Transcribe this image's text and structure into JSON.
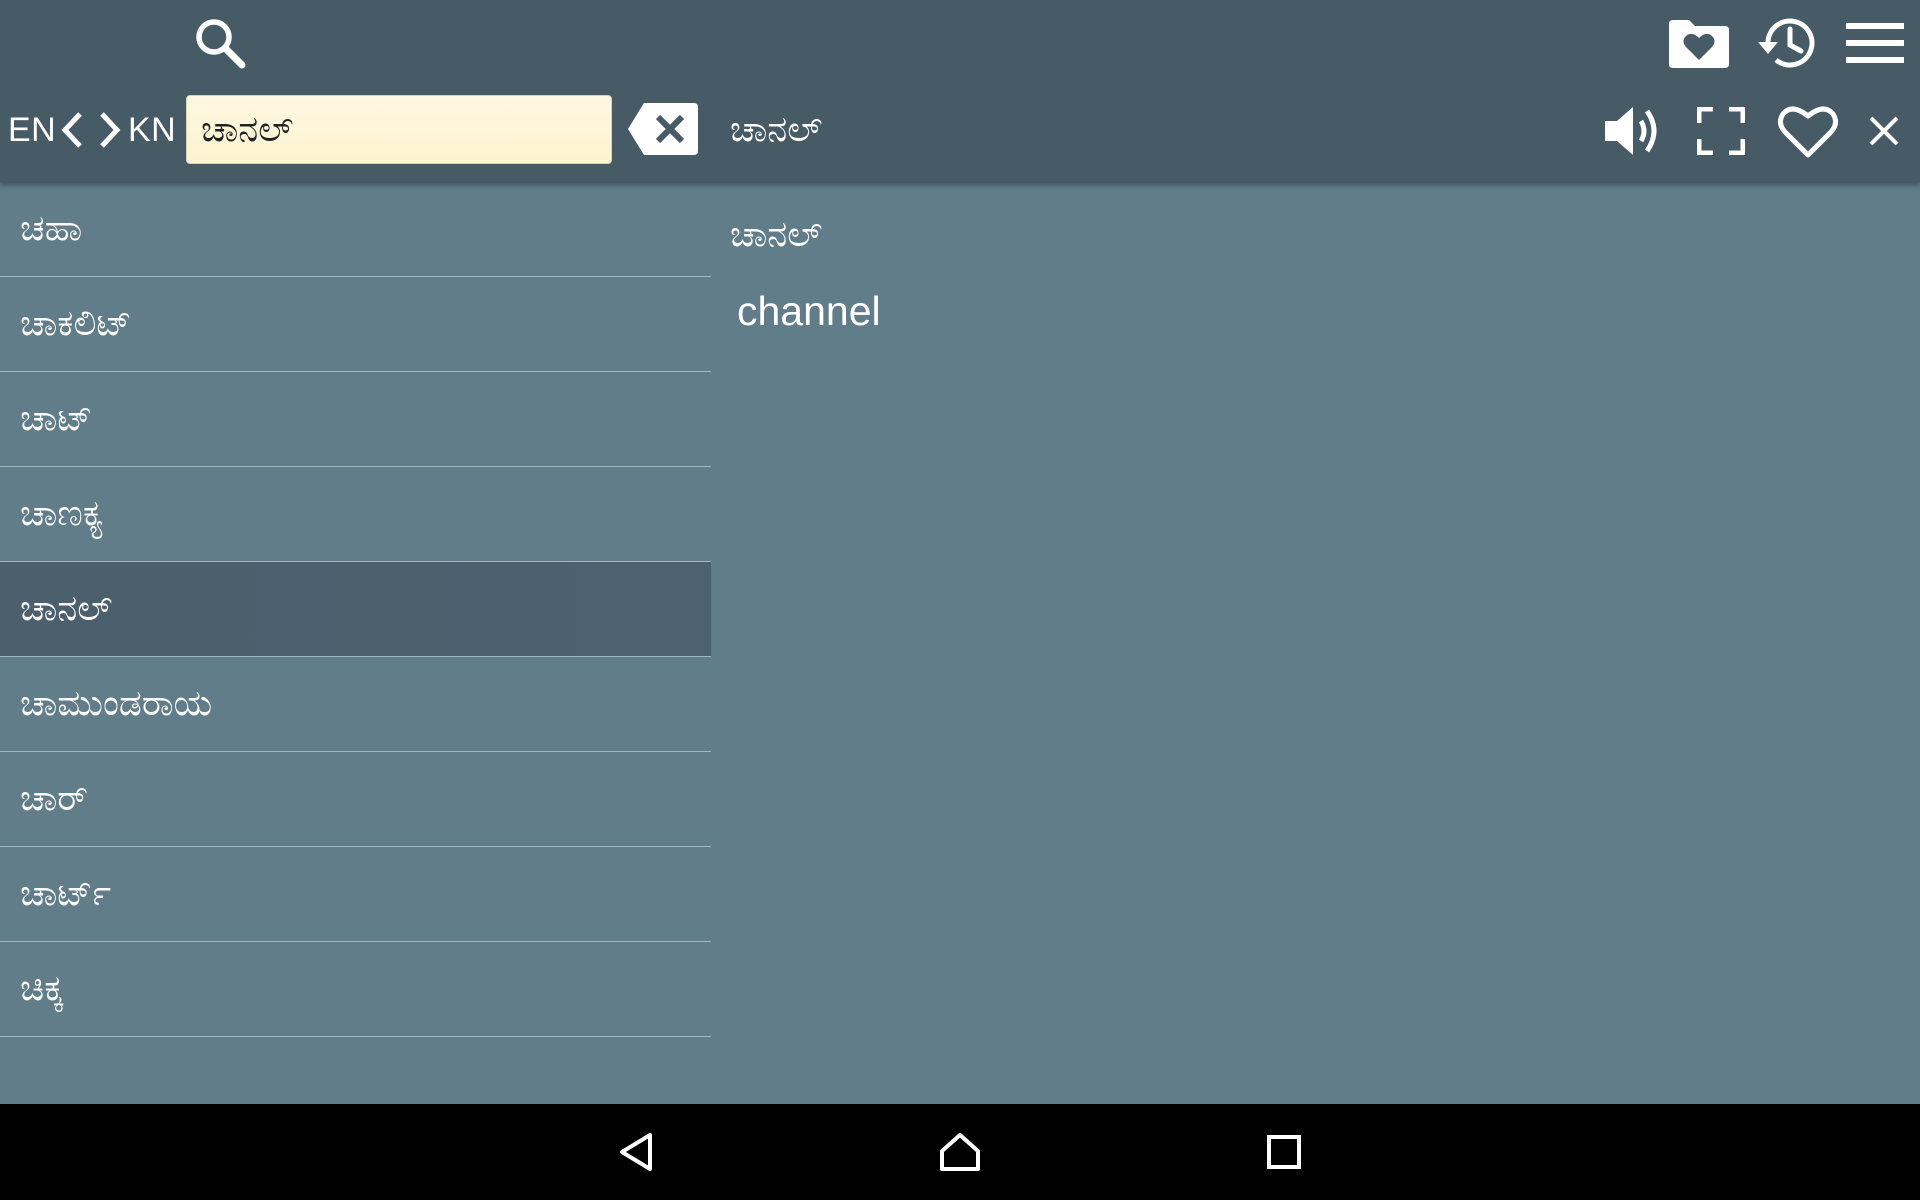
{
  "toolbar": {
    "search_icon": "search-icon",
    "favorites_folder_icon": "favorites-folder-icon",
    "history_icon": "history-icon",
    "menu_icon": "menu-icon"
  },
  "language_bar": {
    "source_lang": "EN",
    "target_lang": "KN",
    "prev_icon": "chevron-left-icon",
    "next_icon": "chevron-right-icon"
  },
  "search": {
    "value": "ಚಾನಲ್",
    "clear_icon": "backspace-clear-icon"
  },
  "header": {
    "current_word": "ಚಾನಲ್",
    "actions": [
      "speaker-icon",
      "fullscreen-icon",
      "heart-icon",
      "close-icon"
    ]
  },
  "word_list": {
    "items": [
      {
        "label": "ಚಹಾ",
        "selected": false
      },
      {
        "label": "ಚಾಕಲಿಟ್",
        "selected": false
      },
      {
        "label": "ಚಾಟ್",
        "selected": false
      },
      {
        "label": "ಚಾಣಕ್ಯ",
        "selected": false
      },
      {
        "label": "ಚಾನಲ್",
        "selected": true
      },
      {
        "label": "ಚಾಮುಂಡರಾಯ",
        "selected": false
      },
      {
        "label": "ಚಾರ್",
        "selected": false
      },
      {
        "label": "ಚಾರ್ಟ್",
        "selected": false
      },
      {
        "label": "ಚಿಕ್ಕ",
        "selected": false
      }
    ]
  },
  "detail": {
    "word": "ಚಾನಲ್",
    "translation": "channel"
  },
  "navbar": {
    "back_icon": "back-triangle-icon",
    "home_icon": "home-icon",
    "recents_icon": "recents-square-icon"
  },
  "colors": {
    "toolbar_bg": "#475b67",
    "content_bg": "#617d8a",
    "selected_row_bg": "#4b5f6c",
    "search_field_bg": "#fff8e2",
    "navbar_bg": "#000000"
  }
}
